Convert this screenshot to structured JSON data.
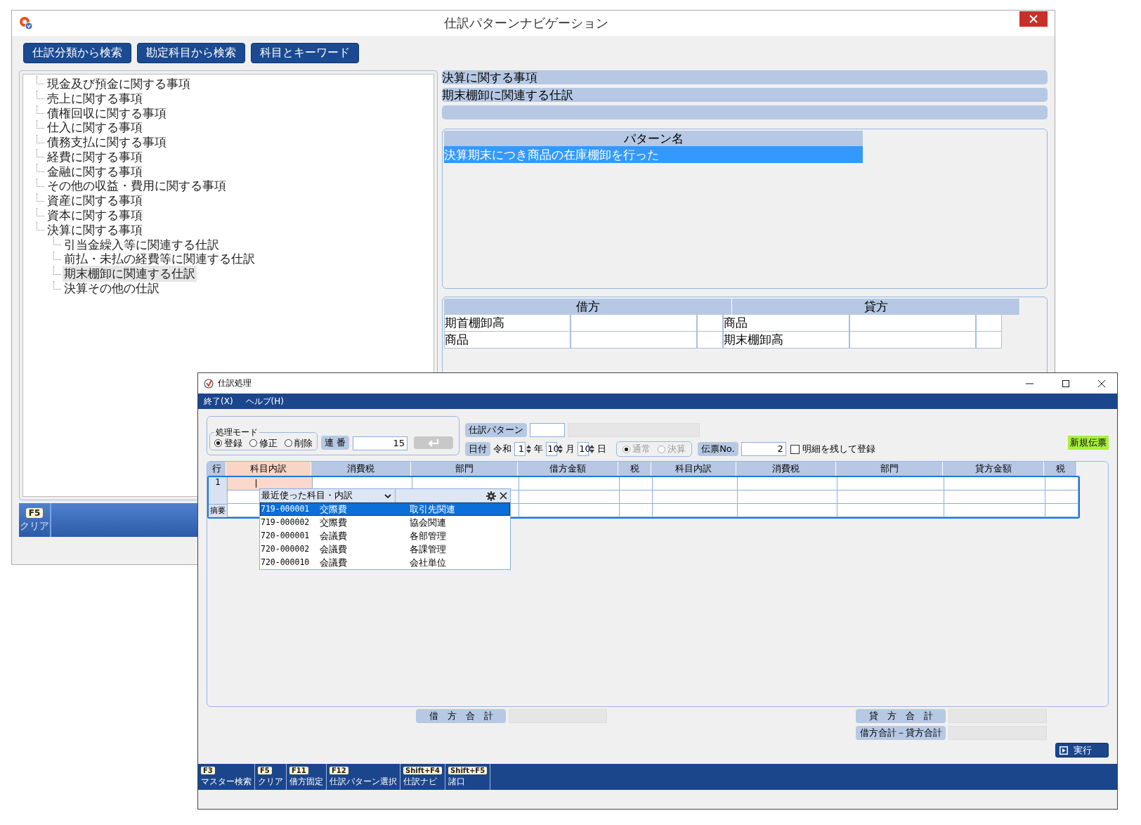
{
  "back_window": {
    "title": "仕訳パターンナビゲーション",
    "search_buttons": [
      "仕訳分類から検索",
      "勘定科目から検索",
      "科目とキーワード"
    ],
    "tree": [
      {
        "label": "現金及び預金に関する事項",
        "selected": false
      },
      {
        "label": "売上に関する事項",
        "selected": false
      },
      {
        "label": "債権回収に関する事項",
        "selected": false
      },
      {
        "label": "仕入に関する事項",
        "selected": false
      },
      {
        "label": "債務支払に関する事項",
        "selected": false
      },
      {
        "label": "経費に関する事項",
        "selected": false
      },
      {
        "label": "金融に関する事項",
        "selected": false
      },
      {
        "label": "その他の収益・費用に関する事項",
        "selected": false
      },
      {
        "label": "資産に関する事項",
        "selected": false
      },
      {
        "label": "資本に関する事項",
        "selected": false
      },
      {
        "label": "決算に関する事項",
        "selected": false,
        "children": [
          {
            "label": "引当金繰入等に関連する仕訳",
            "selected": false
          },
          {
            "label": "前払・未払の経費等に関連する仕訳",
            "selected": false
          },
          {
            "label": "期末棚卸に関連する仕訳",
            "selected": true
          },
          {
            "label": "決算その他の仕訳",
            "selected": false
          }
        ]
      }
    ],
    "breadcrumb": [
      "決算に関する事項",
      "期末棚卸に関連する仕訳"
    ],
    "pattern_list": {
      "header": "パターン名",
      "rows": [
        {
          "text": "決算期末につき商品の在庫棚卸を行った",
          "selected": true
        }
      ]
    },
    "entries": {
      "debit_header": "借方",
      "credit_header": "貸方",
      "rows": [
        {
          "debit": "期首棚卸高",
          "credit": "商品"
        },
        {
          "debit": "商品",
          "credit": "期末棚卸高"
        }
      ]
    },
    "function_keys": [
      {
        "key": "F5",
        "label": "クリア"
      }
    ]
  },
  "front_window": {
    "title": "仕訳処理",
    "menu": [
      "終了(X)",
      "ヘルプ(H)"
    ],
    "mode": {
      "label": "処理モード",
      "options": [
        {
          "label": "登録",
          "selected": true
        },
        {
          "label": "修正",
          "selected": false
        },
        {
          "label": "削除",
          "selected": false
        }
      ]
    },
    "serial": {
      "label": "連 番",
      "value": "15"
    },
    "enter_button": {
      "disabled": true
    },
    "pattern": {
      "label": "仕訳パターン"
    },
    "date": {
      "label": "日付",
      "era": "令和",
      "year": "1",
      "year_unit": "年",
      "month": "10",
      "month_unit": "月",
      "day": "10",
      "day_unit": "日"
    },
    "entry_type": {
      "disabled": true,
      "options": [
        {
          "label": "通常",
          "selected": true
        },
        {
          "label": "決算",
          "selected": false
        }
      ]
    },
    "slip": {
      "label": "伝票No.",
      "value": "2"
    },
    "keep_details": {
      "label": "明細を残して登録",
      "checked": false
    },
    "status_badge": "新規伝票",
    "grid": {
      "columns": [
        {
          "label": "行",
          "selected": false
        },
        {
          "label": "科目内訳",
          "selected": true
        },
        {
          "label": "消費税",
          "selected": false
        },
        {
          "label": "部門",
          "selected": false
        },
        {
          "label": "借方金額",
          "selected": false
        },
        {
          "label": "税",
          "selected": false
        },
        {
          "label": "科目内訳",
          "selected": false
        },
        {
          "label": "消費税",
          "selected": false
        },
        {
          "label": "部門",
          "selected": false
        },
        {
          "label": "貸方金額",
          "selected": false
        },
        {
          "label": "税",
          "selected": false
        }
      ],
      "row_number": "1",
      "memo_label": "摘要"
    },
    "dropdown": {
      "title": "最近使った科目・内訳",
      "items": [
        {
          "code": "719-000001",
          "name": "交際費",
          "detail": "取引先関連",
          "selected": true
        },
        {
          "code": "719-000002",
          "name": "交際費",
          "detail": "協会関連",
          "selected": false
        },
        {
          "code": "720-000001",
          "name": "会議費",
          "detail": "各部管理",
          "selected": false
        },
        {
          "code": "720-000002",
          "name": "会議費",
          "detail": "各課管理",
          "selected": false
        },
        {
          "code": "720-000010",
          "name": "会議費",
          "detail": "会社単位",
          "selected": false
        }
      ]
    },
    "totals": {
      "debit_label": "借　方　合　計",
      "credit_label": "貸　方　合　計",
      "difference_label": "借方合計－貸方合計"
    },
    "execute_button": "実行",
    "function_keys": [
      {
        "key": "F3",
        "label": "マスター検索"
      },
      {
        "key": "F5",
        "label": "クリア"
      },
      {
        "key": "F11",
        "label": "借方固定"
      },
      {
        "key": "F12",
        "label": "仕訳パターン選択"
      },
      {
        "key": "Shift+F4",
        "label": "仕訳ナビ"
      },
      {
        "key": "Shift+F5",
        "label": "諸口"
      }
    ]
  }
}
